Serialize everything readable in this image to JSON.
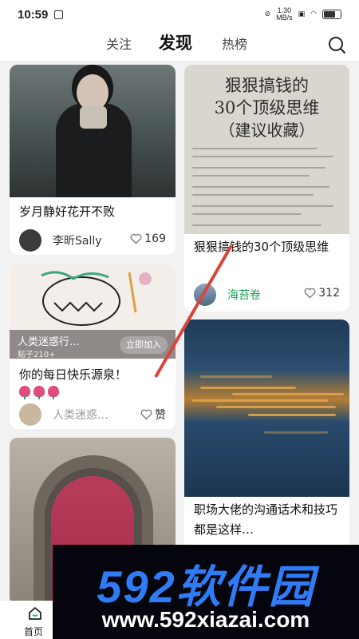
{
  "status_bar": {
    "time": "10:59",
    "speed_value": "1.30",
    "speed_unit": "MB/s",
    "battery_level": 0.72
  },
  "header": {
    "tabs": [
      "关注",
      "发现",
      "热榜"
    ],
    "active_tab": "发现"
  },
  "feed": {
    "card1": {
      "title": "岁月静好花开不败",
      "author": "李昕Sally",
      "likes": "169"
    },
    "card2": {
      "poster_line1": "狠狠搞钱的",
      "poster_line2": "30个顶级思维",
      "poster_line3": "（建议收藏）",
      "title": "狠狠搞钱的30个顶级思维",
      "author": "海苔卷",
      "likes": "312"
    },
    "card3": {
      "group_name": "人类迷惑行…",
      "group_posts": "贴子210+",
      "join_label": "立即加入",
      "title": "你的每日快乐源泉！",
      "author": "人类迷惑…",
      "likes": "赞"
    },
    "card5": {
      "title": "职场大佬的沟通话术和技巧都是这样…"
    }
  },
  "bottom_nav": {
    "home_label": "首页"
  },
  "watermark": {
    "top": "592软件园",
    "bottom": "www.592xiazai.com"
  },
  "colors": {
    "accent": "#2f7cf6",
    "author_green": "#1aa356",
    "heart": "#777777"
  }
}
